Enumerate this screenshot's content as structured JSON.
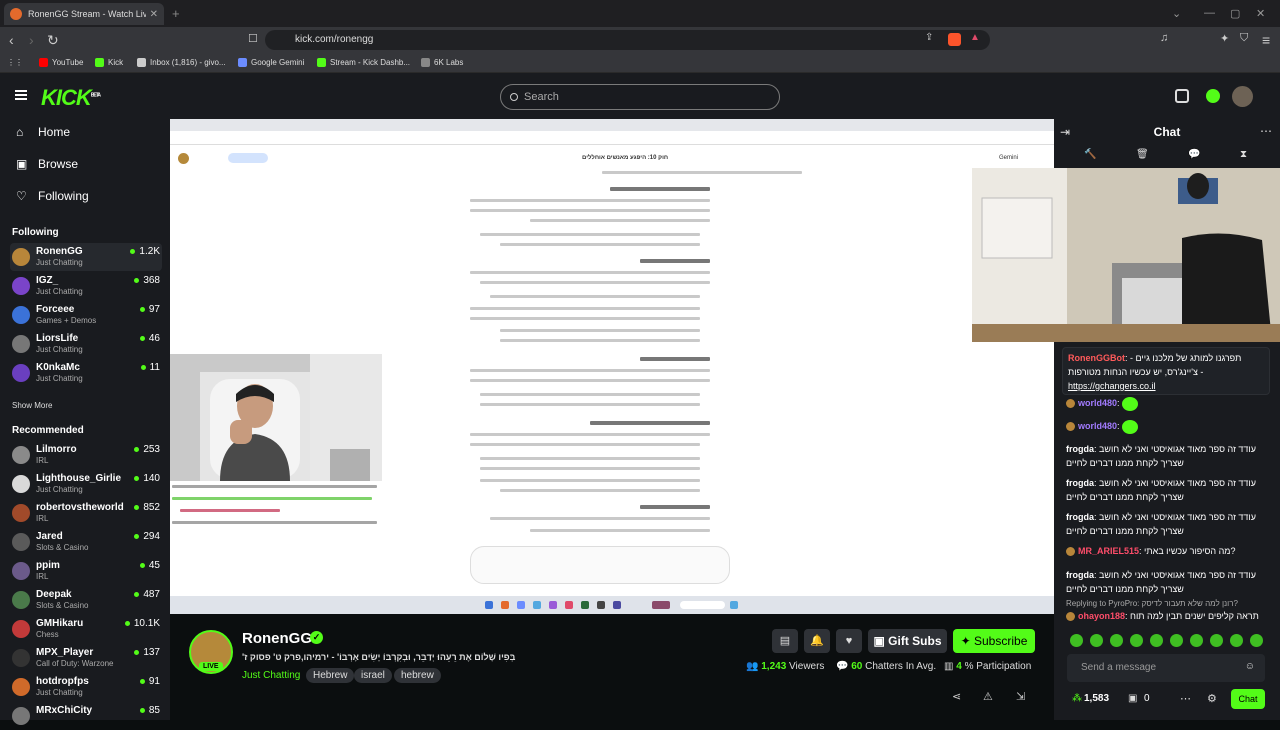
{
  "browser": {
    "tab_title": "RonenGG Stream - Watch Live",
    "url": "kick.com/ronengg",
    "bookmarks": [
      "YouTube",
      "Kick",
      "Inbox (1,816) - givo...",
      "Google Gemini",
      "Stream - Kick Dashb...",
      "6K Labs"
    ]
  },
  "kick": {
    "logo": "KICK",
    "logo_beta": "BETA",
    "search_placeholder": "Search"
  },
  "sidebar": {
    "nav": [
      {
        "label": "Home",
        "icon": "home-icon"
      },
      {
        "label": "Browse",
        "icon": "browse-icon"
      },
      {
        "label": "Following",
        "icon": "heart-icon"
      }
    ],
    "following_title": "Following",
    "following": [
      {
        "name": "RonenGG",
        "category": "Just Chatting",
        "viewers": "1.2K",
        "color": "#b8863a"
      },
      {
        "name": "IGZ_",
        "category": "Just Chatting",
        "viewers": "368",
        "color": "#7a44c9"
      },
      {
        "name": "Forceee",
        "category": "Games + Demos",
        "viewers": "97",
        "color": "#3b72d8"
      },
      {
        "name": "LiorsLife",
        "category": "Just Chatting",
        "viewers": "46",
        "color": "#777777"
      },
      {
        "name": "K0nkaMc",
        "category": "Just Chatting",
        "viewers": "11",
        "color": "#6a3fc0"
      }
    ],
    "show_more": "Show More",
    "recommended_title": "Recommended",
    "recommended": [
      {
        "name": "Lilmorro",
        "category": "IRL",
        "viewers": "253",
        "color": "#8a8a8a"
      },
      {
        "name": "Lighthouse_Girlie",
        "category": "Just Chatting",
        "viewers": "140",
        "color": "#d9d9d9"
      },
      {
        "name": "robertovstheworld",
        "category": "IRL",
        "viewers": "852",
        "color": "#a14a2a"
      },
      {
        "name": "Jared",
        "category": "Slots & Casino",
        "viewers": "294",
        "color": "#5a5a5a"
      },
      {
        "name": "ppim",
        "category": "IRL",
        "viewers": "45",
        "color": "#6b5a8a"
      },
      {
        "name": "Deepak",
        "category": "Slots & Casino",
        "viewers": "487",
        "color": "#4a7a4a"
      },
      {
        "name": "GMHikaru",
        "category": "Chess",
        "viewers": "10.1K",
        "color": "#c23a3a"
      },
      {
        "name": "MPX_Player",
        "category": "Call of Duty: Warzone",
        "viewers": "137",
        "color": "#333333"
      },
      {
        "name": "hotdropfps",
        "category": "Just Chatting",
        "viewers": "91",
        "color": "#d06a2a"
      },
      {
        "name": "MRxChiCity",
        "category": "",
        "viewers": "85",
        "color": "#777777"
      }
    ]
  },
  "stream": {
    "gemini_title": "Gemini",
    "gemini_heading": "חוק 10: היפגע מאנשים אוחללים",
    "name": "RonenGG",
    "live": "LIVE",
    "title": "'בְּפִיו שָׁלוֹם אֶת רֵעֵהוּ יְדַבֵּר, וּבְקִרְבּוֹ יָשִׂים אָרְבּוֹ' - ירמיהו,פרק ט' פסוק ז",
    "category": "Just Chatting",
    "tags": [
      "Hebrew",
      "israel",
      "hebrew"
    ],
    "gift_label": "Gift Subs",
    "subscribe_label": "Subscribe",
    "viewers": "1,243",
    "viewers_label": "Viewers",
    "chatters": "60",
    "chatters_label": "Chatters In Avg.",
    "participation": "4",
    "participation_label": "% Participation"
  },
  "chat": {
    "title": "Chat",
    "pinned_user": "RonenGGBot",
    "pinned_text": "תפרגנו למותג של מלכנו גיים - צ'יינג'רס, יש עכשיו הנחות מטורפות -",
    "pinned_link": "https://gchangers.co.il",
    "messages": [
      {
        "user": "world480",
        "color": "#a27bff",
        "text": "",
        "emote": true
      },
      {
        "user": "world480",
        "color": "#a27bff",
        "text": "",
        "emote": true
      },
      {
        "user": "frogda",
        "color": "#ffffff",
        "text": "עודד זה ספר מאוד אגואיסטי ואני לא חושב שצריך לקחת ממנו דברים לחיים",
        "emote": false
      },
      {
        "user": "frogda",
        "color": "#ffffff",
        "text": "עודד זה ספר מאוד אגואיסטי ואני לא חושב שצריך לקחת ממנו דברים לחיים",
        "emote": false
      },
      {
        "user": "frogda",
        "color": "#ffffff",
        "text": "עודד זה ספר מאוד אגואיסטי ואני לא חושב שצריך לקחת ממנו דברים לחיים",
        "emote": false
      },
      {
        "user": "MR_ARIEL515",
        "color": "#ff4d6a",
        "text": "מה הסיפור עכשיו באתי?",
        "emote": false
      },
      {
        "user": "frogda",
        "color": "#ffffff",
        "text": "עודד זה ספר מאוד אגואיסטי ואני לא חושב שצריך לקחת ממנו דברים לחיים",
        "emote": false
      }
    ],
    "reply_hint": "Replying to PyroPro: רונן למה שלא תעבור לדיסק?",
    "last_user": "ohayon188",
    "last_text": "תראה קליפים ישנים תבין למה תוח",
    "input_placeholder": "Send a message",
    "points": "1,583",
    "gift_count": "0",
    "chat_button": "Chat"
  }
}
